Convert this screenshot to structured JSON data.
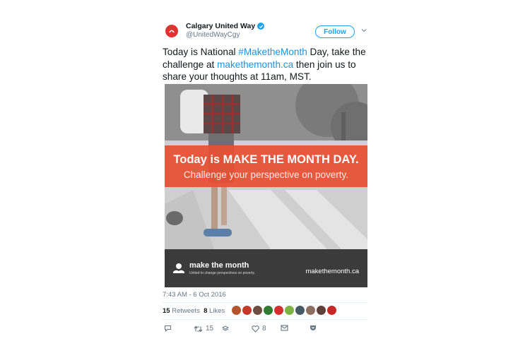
{
  "tweet": {
    "author": {
      "display_name": "Calgary United Way",
      "handle": "@UnitedWayCgy",
      "verified": true,
      "avatar_color": "#e0322e"
    },
    "follow_label": "Follow",
    "text_segments": [
      {
        "text": "Today is National ",
        "type": "text"
      },
      {
        "text": "#MaketheMonth",
        "type": "hashtag"
      },
      {
        "text": " Day, take the challenge at ",
        "type": "text"
      },
      {
        "text": "makethemonth.ca",
        "type": "link"
      },
      {
        "text": " then join us to share your thoughts at 11am, MST.",
        "type": "text"
      }
    ],
    "media": {
      "banner_line1": "Today is MAKE THE MONTH DAY.",
      "banner_line2": "Challenge your perspective on poverty.",
      "brand_name": "make the month",
      "brand_tagline": "United to change perspectives on poverty.",
      "brand_url": "makethemonth.ca",
      "banner_color": "#e85034",
      "footer_color": "#3b3b3b"
    },
    "timestamp": "7:43 AM - 6 Oct 2016",
    "stats": {
      "retweets_count": "15",
      "retweets_label": "Retweets",
      "likes_count": "8",
      "likes_label": "Likes"
    },
    "liker_avatar_colors": [
      "#b5542c",
      "#c0392b",
      "#6d4c41",
      "#2e7d32",
      "#d32f2f",
      "#7cb342",
      "#455a64",
      "#8d6e63",
      "#5d4037",
      "#c62828"
    ],
    "actions": {
      "reply_icon": "reply-icon",
      "retweet_icon": "retweet-icon",
      "retweet_count": "15",
      "like_icon": "heart-icon",
      "like_count": "8",
      "dm_icon": "envelope-icon",
      "pocket_icon": "pocket-icon"
    },
    "accent_color": "#1da1f2"
  }
}
